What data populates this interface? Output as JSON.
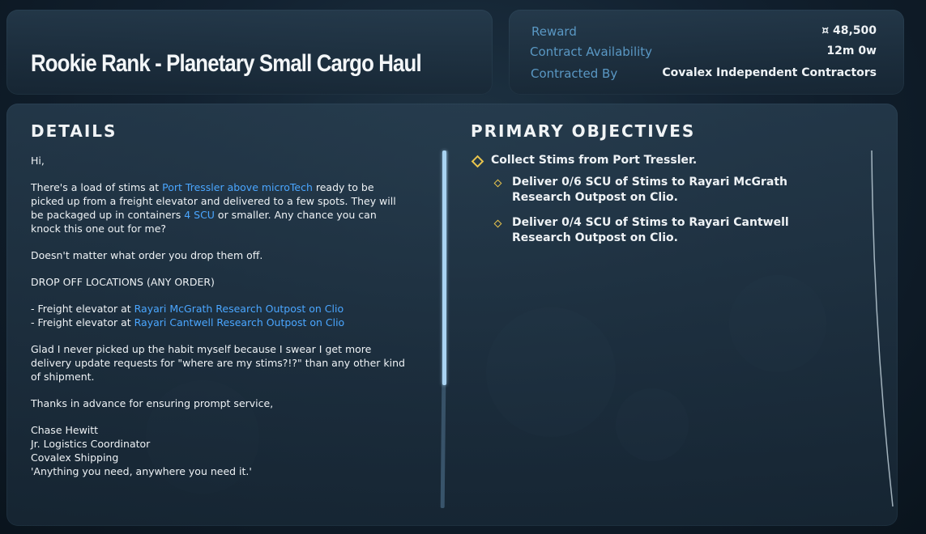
{
  "header": {
    "title": "Rookie Rank - Planetary Small Cargo Haul"
  },
  "contract_info": {
    "reward_label": "Reward",
    "reward_value": "¤ 48,500",
    "availability_label": "Contract Availability",
    "availability_value": "12m 0w",
    "contracted_by_label": "Contracted By",
    "contracted_by_value": "Covalex Independent Contractors"
  },
  "details": {
    "heading": "DETAILS",
    "greeting": "Hi,",
    "p1_a": "There's a load of stims at ",
    "p1_link1": "Port Tressler above microTech",
    "p1_b": " ready to be picked up from a freight elevator and delivered to a few spots. They will be packaged up in containers ",
    "p1_link2": "4 SCU",
    "p1_c": " or smaller. Any chance you can knock this one out for me?",
    "p2": "Doesn't matter what order you drop them off.",
    "p3": "DROP OFF LOCATIONS (ANY ORDER)",
    "loc1_prefix": "- Freight elevator at ",
    "loc1_link": "Rayari McGrath Research Outpost on Clio",
    "loc2_prefix": "- Freight elevator at ",
    "loc2_link": "Rayari Cantwell Research Outpost on Clio",
    "p4": "Glad I never picked up the habit myself because I swear I get more delivery update requests for \"where are my stims?!?\" than any other kind of shipment.",
    "p5": "Thanks in advance for ensuring prompt service,",
    "sig_name": "Chase Hewitt",
    "sig_title": "Jr. Logistics Coordinator",
    "sig_company": "Covalex Shipping",
    "sig_motto": "'Anything you need, anywhere you need it.'"
  },
  "objectives": {
    "heading": "PRIMARY OBJECTIVES",
    "main": "Collect Stims from Port Tressler.",
    "sub1_line1": "Deliver 0/6 SCU of Stims to Rayari McGrath",
    "sub1_line2": "Research Outpost on Clio.",
    "sub2_line1": "Deliver 0/4 SCU of Stims to Rayari Cantwell",
    "sub2_line2": "Research Outpost on Clio."
  },
  "colors": {
    "accent_link": "#4aa6ff",
    "label_blue": "#5a98c4",
    "objective_marker": "#e9c54d"
  },
  "icons": {
    "objective_marker": "diamond-icon"
  }
}
